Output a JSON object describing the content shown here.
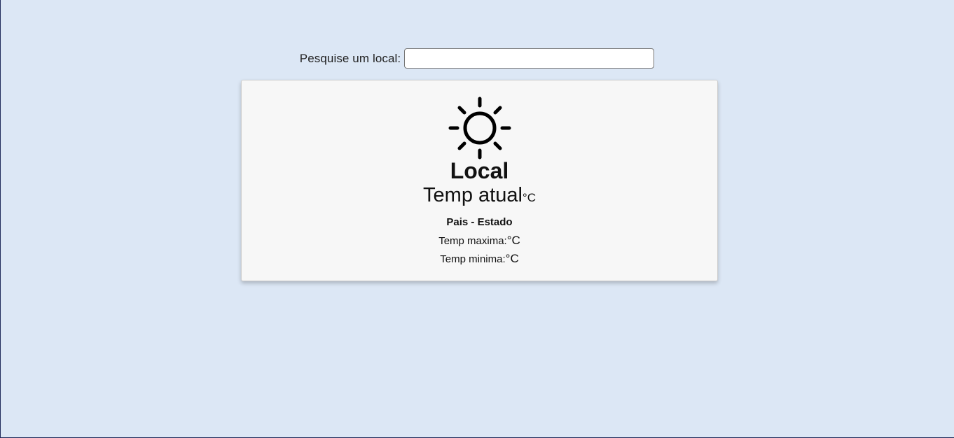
{
  "search": {
    "label": "Pesquise um local:",
    "value": "",
    "placeholder": ""
  },
  "weather": {
    "icon": "sun-icon",
    "place": "Local",
    "current_temp": "Temp atual",
    "current_unit": "°C",
    "region": "Pais - Estado",
    "max_label": "Temp maxima:",
    "max_unit": "°C",
    "min_label": "Temp minima:",
    "min_unit": "°C"
  },
  "colors": {
    "background": "#dce7f5",
    "card": "#f7f7f7",
    "text": "#111111"
  }
}
